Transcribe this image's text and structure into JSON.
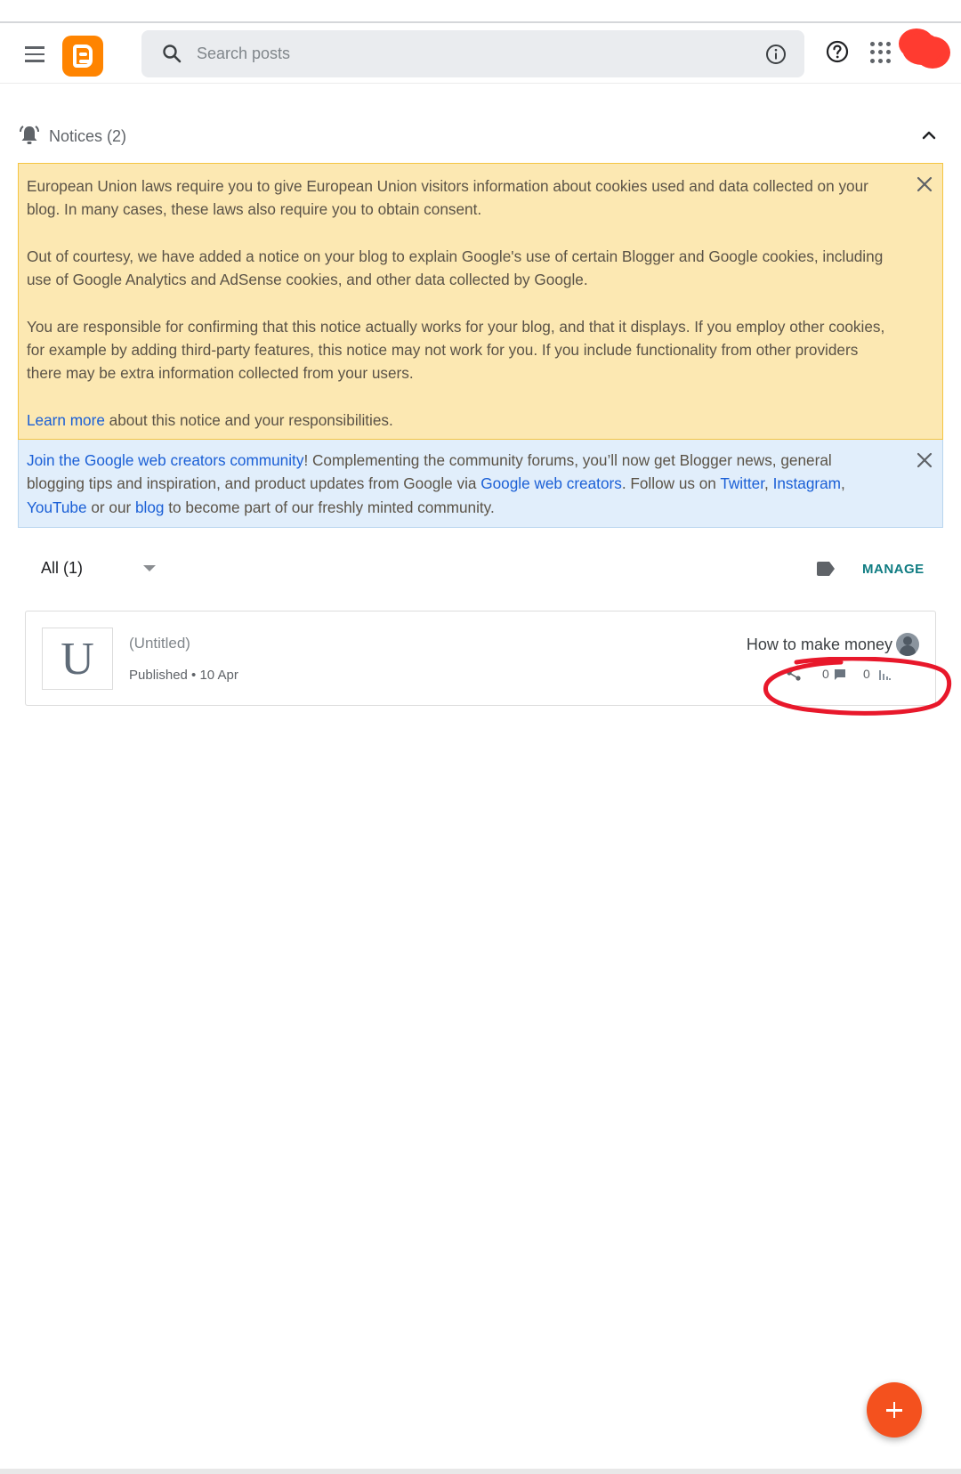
{
  "header": {
    "search_placeholder": "Search posts"
  },
  "notices": {
    "label": "Notices (2)",
    "eu_notice": {
      "p1": "European Union laws require you to give European Union visitors information about cookies used and data collected on your blog. In many cases, these laws also require you to obtain consent.",
      "p2": "Out of courtesy, we have added a notice on your blog to explain Google's use of certain Blogger and Google cookies, including use of Google Analytics and AdSense cookies, and other data collected by Google.",
      "p3": "You are responsible for confirming that this notice actually works for your blog, and that it displays. If you employ other cookies, for example by adding third-party features, this notice may not work for you. If you include functionality from other providers there may be extra information collected from your users.",
      "learn_more_link": "Learn more",
      "learn_more_rest": " about this notice and your responsibilities."
    },
    "community_notice": {
      "link_join": "Join the Google web creators community",
      "text1": "! Complementing the community forums, you’ll now get Blogger news, general blogging tips and inspiration, and product updates from Google via ",
      "link_gwc": "Google web creators",
      "text2": ". Follow us on ",
      "link_twitter": "Twitter",
      "text3": ", ",
      "link_instagram": "Instagram",
      "text4": ", ",
      "link_youtube": "YouTube",
      "text5": " or our ",
      "link_blog": "blog",
      "text6": " to become part of our freshly minted community."
    }
  },
  "filter": {
    "selected": "All (1)",
    "manage_label": "MANAGE"
  },
  "posts": [
    {
      "thumb_letter": "U",
      "title": "(Untitled)",
      "status": "Published • 10 Apr",
      "label": "How to make money",
      "comments": "0",
      "views": "0"
    }
  ],
  "colors": {
    "brand": "#ff8400",
    "fab": "#f4511e",
    "notice_yellow": "#fce8b2",
    "notice_blue": "#e1eefb",
    "link": "#1a5fd6",
    "manage": "#0f7c82",
    "annotation": "#e8182b"
  },
  "icons": [
    "menu-icon",
    "blogger-logo",
    "search-icon",
    "info-icon",
    "help-icon",
    "apps-icon",
    "bell-icon",
    "chevron-up-icon",
    "close-icon",
    "dropdown-caret-icon",
    "label-icon",
    "share-icon",
    "comment-icon",
    "stats-icon",
    "add-icon"
  ]
}
